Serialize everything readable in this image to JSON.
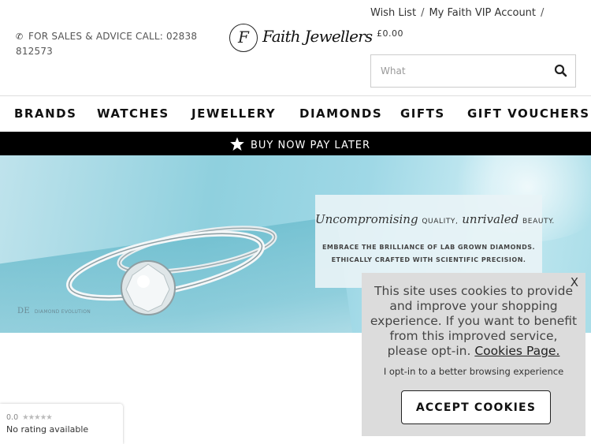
{
  "header": {
    "sales_text": "FOR SALES & ADVICE CALL: 02838 812573",
    "logo_initial": "F",
    "logo_text": "Faith Jewellers",
    "top_links": [
      "Wish List",
      "My Faith VIP Account"
    ],
    "separator": "/",
    "basket_total": "£0.00",
    "search_placeholder": "What"
  },
  "nav": {
    "items": [
      "BRANDS",
      "WATCHES",
      "JEWELLERY",
      "DIAMONDS",
      "GIFTS",
      "GIFT VOUCHERS"
    ]
  },
  "promo": {
    "label": "BUY NOW PAY LATER"
  },
  "banner": {
    "headline_1": "Uncompromising",
    "headline_2": "QUALITY,",
    "headline_3": "unrivaled",
    "headline_4": "BEAUTY.",
    "line_1": "EMBRACE THE BRILLIANCE OF LAB GROWN DIAMONDS.",
    "line_2": "ETHICALLY CRAFTED WITH SCIENTIFIC PRECISION.",
    "brand_mark_initials": "DE",
    "brand_mark_name": "DIAMOND EVOLUTION"
  },
  "cookie": {
    "close_label": "X",
    "message": "This site uses cookies to provide and improve your shopping experience. If you want to benefit from this improved service, please opt-in.",
    "link_label": "Cookies Page.",
    "optin_text": "I opt-in to a better browsing experience",
    "accept_label": "ACCEPT COOKIES"
  },
  "rating": {
    "score": "0.0",
    "stars": "★★★★★",
    "text": "No rating available"
  },
  "colors": {
    "promo_bg": "#000000",
    "cookie_bg": "#dcdcdc",
    "banner_accent": "#8fd0de"
  },
  "icons": [
    "phone-icon",
    "search-icon",
    "star-icon"
  ]
}
